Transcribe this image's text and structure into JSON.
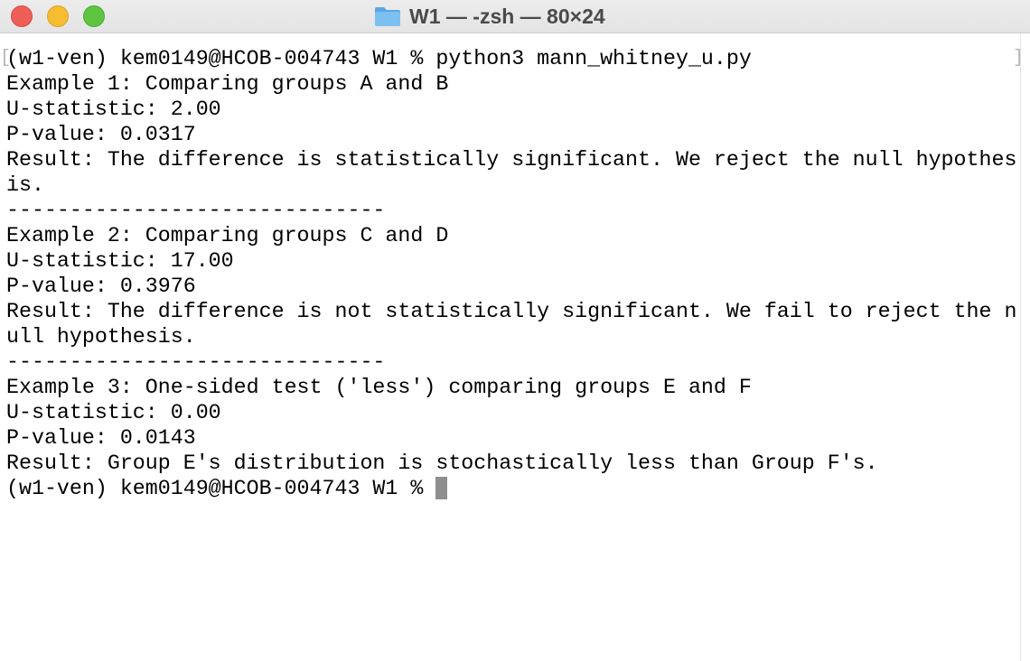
{
  "window": {
    "title": "W1 — -zsh — 80×24",
    "folder_icon": "folder-icon",
    "traffic_lights": {
      "close_color": "#ee5e56",
      "minimize_color": "#f5bd2f",
      "zoom_color": "#5fc541"
    }
  },
  "terminal": {
    "bracket_left": "[",
    "bracket_right": "]",
    "lines": [
      "(w1-ven) kem0149@HCOB-004743 W1 % python3 mann_whitney_u.py",
      "Example 1: Comparing groups A and B",
      "U-statistic: 2.00",
      "P-value: 0.0317",
      "Result: The difference is statistically significant. We reject the null hypothes",
      "is.",
      "------------------------------",
      "Example 2: Comparing groups C and D",
      "U-statistic: 17.00",
      "P-value: 0.3976",
      "Result: The difference is not statistically significant. We fail to reject the n",
      "ull hypothesis.",
      "------------------------------",
      "Example 3: One-sided test ('less') comparing groups E and F",
      "U-statistic: 0.00",
      "P-value: 0.0143",
      "Result: Group E's distribution is stochastically less than Group F's."
    ],
    "prompt": "(w1-ven) kem0149@HCOB-004743 W1 % "
  }
}
